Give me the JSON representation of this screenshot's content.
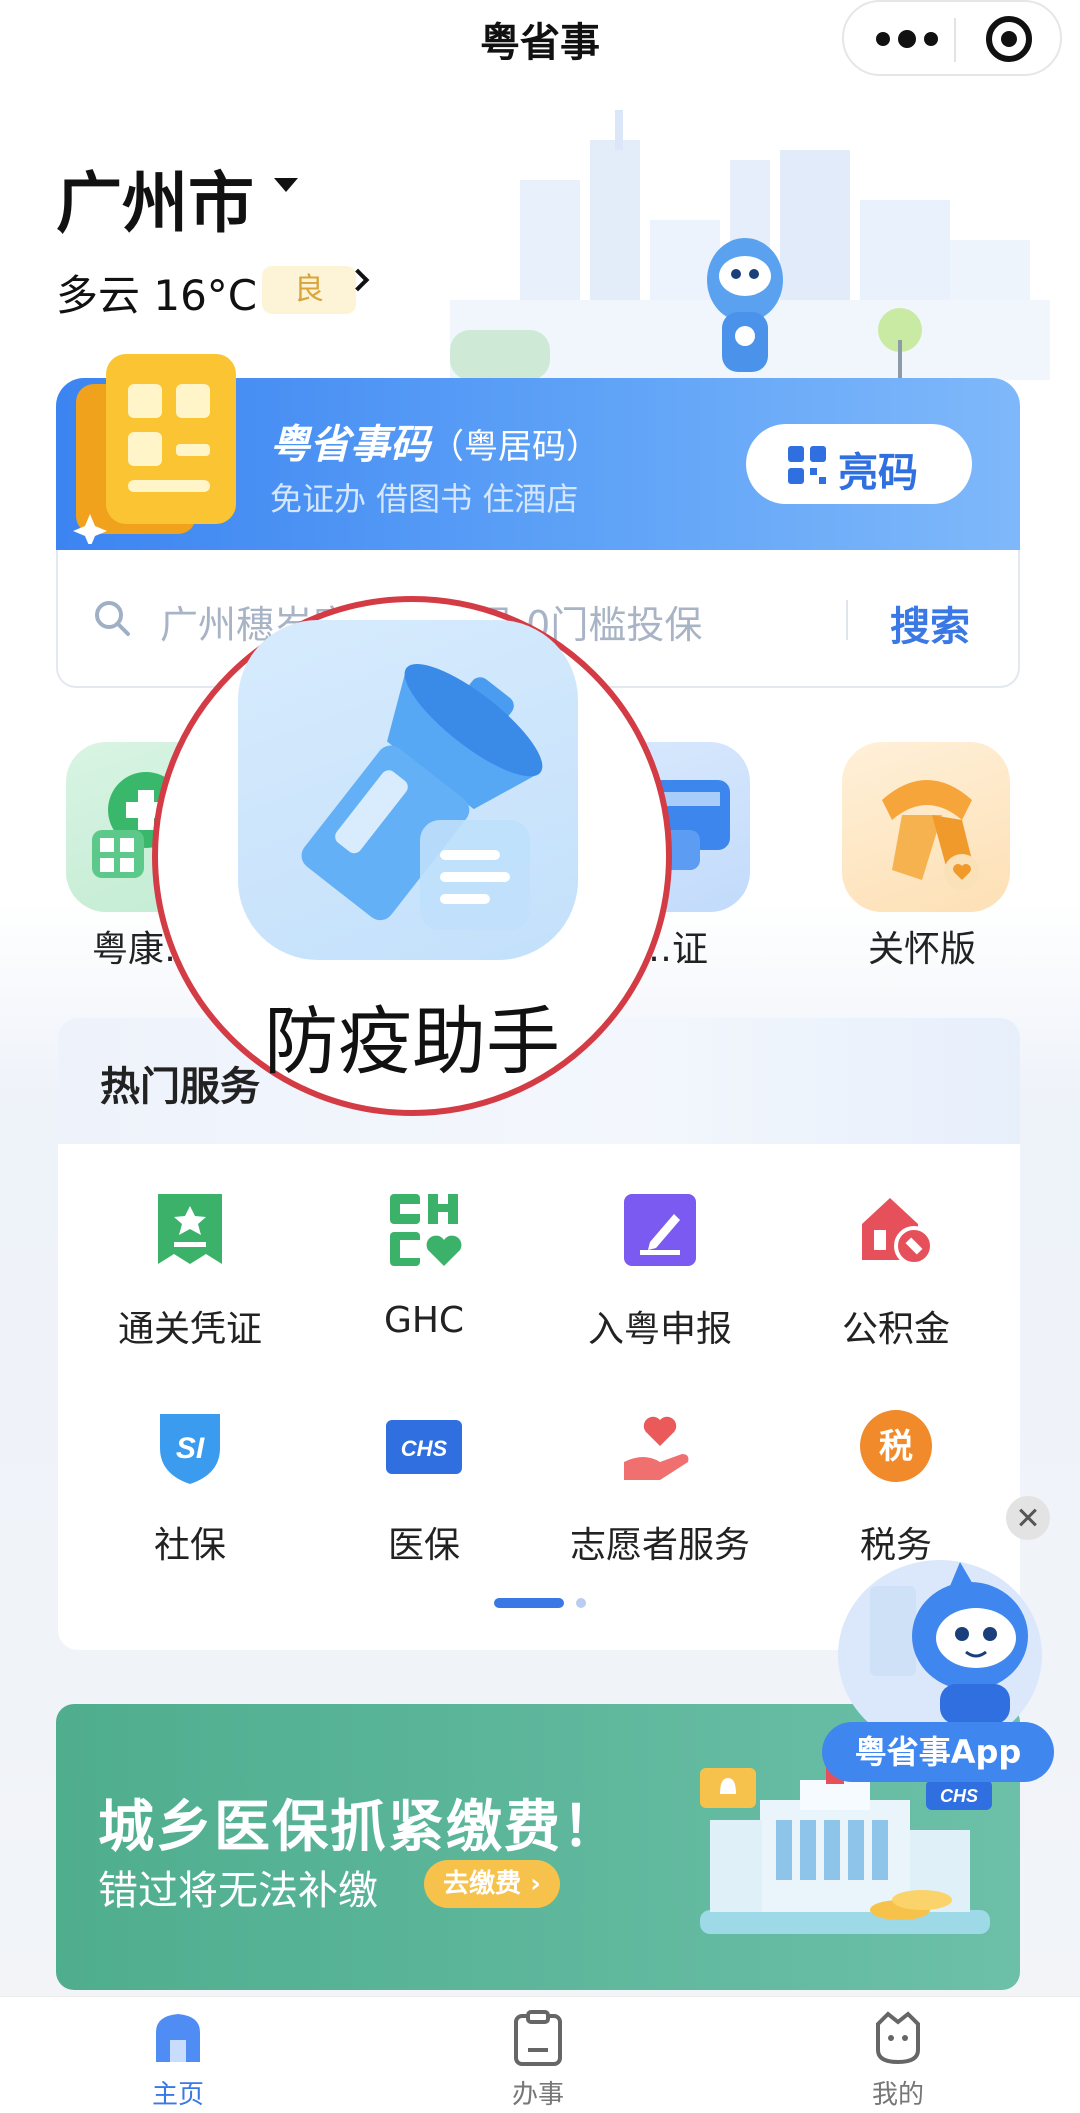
{
  "app": {
    "title": "粤省事"
  },
  "location": {
    "city": "广州市"
  },
  "weather": {
    "text": "多云 16°C",
    "aqi": "良"
  },
  "code_banner": {
    "title": "粤省事码",
    "title_suffix": "（粤居码）",
    "subtitle": "免证办 借图书 住酒店",
    "button_label": "亮码"
  },
  "search": {
    "placeholder": "广州穗岁康…  …指导 0门槛投保",
    "button_label": "搜索"
  },
  "quick_actions": [
    {
      "label": "粤康…",
      "icon": "health-code-icon"
    },
    {
      "label": "…证",
      "icon": "card-wallet-icon"
    },
    {
      "label": "关怀版",
      "icon": "care-ribbon-icon"
    }
  ],
  "magnifier": {
    "label": "防疫助手",
    "icon": "flashlight-icon"
  },
  "hot_services": {
    "title": "热门服务",
    "items": [
      {
        "label": "通关凭证",
        "icon": "pass-certificate-icon",
        "color": "#3bb16a"
      },
      {
        "label": "GHC",
        "icon": "ghc-icon",
        "color": "#3bb16a"
      },
      {
        "label": "入粤申报",
        "icon": "declare-edit-icon",
        "color": "#7a5af0"
      },
      {
        "label": "公积金",
        "icon": "house-fund-icon",
        "color": "#e5505a"
      },
      {
        "label": "社保",
        "icon": "social-security-icon",
        "color": "#3a9bef"
      },
      {
        "label": "医保",
        "icon": "chs-icon",
        "color": "#2f6fe0"
      },
      {
        "label": "志愿者服务",
        "icon": "volunteer-heart-icon",
        "color": "#ea5a5a"
      },
      {
        "label": "税务",
        "icon": "tax-icon",
        "color": "#f08a2a"
      }
    ],
    "page_count": 2,
    "current_page": 1
  },
  "floating_promo": {
    "label": "粤省事App"
  },
  "promo_banner": {
    "title": "城乡医保抓紧缴费！",
    "subtitle": "错过将无法补缴",
    "button_label": "去缴费",
    "tag": "CHS"
  },
  "tabbar": [
    {
      "label": "主页",
      "icon": "home-icon",
      "active": true
    },
    {
      "label": "办事",
      "icon": "clipboard-icon",
      "active": false
    },
    {
      "label": "我的",
      "icon": "profile-icon",
      "active": false
    }
  ],
  "colors": {
    "accent": "#3a78e6",
    "lens_border": "#d43c45",
    "promo_green": "#57b394"
  }
}
